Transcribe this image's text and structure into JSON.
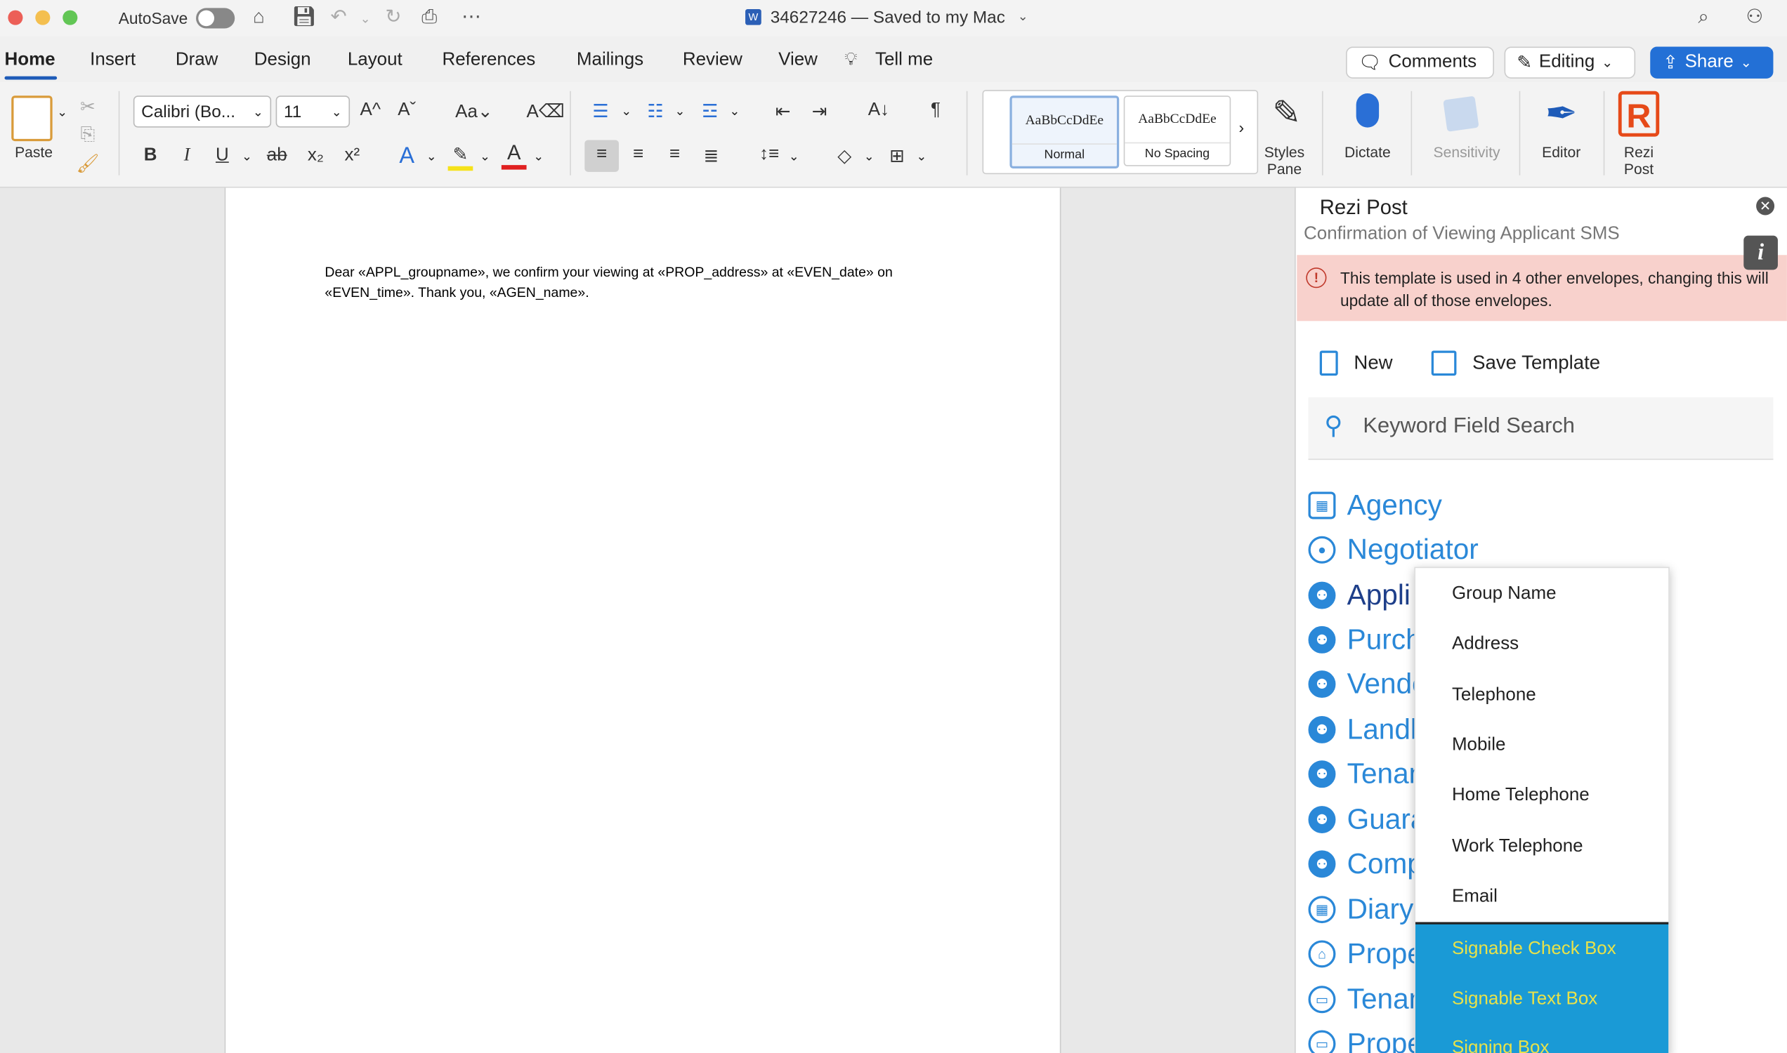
{
  "titlebar": {
    "autosave_label": "AutoSave",
    "doc_title": "34627246 — Saved to my Mac",
    "icons": [
      "home-icon",
      "save-icon",
      "undo-icon",
      "redo-icon",
      "print-icon",
      "more-icon",
      "search-icon",
      "share-people-icon"
    ]
  },
  "tabs": [
    "Home",
    "Insert",
    "Draw",
    "Design",
    "Layout",
    "References",
    "Mailings",
    "Review",
    "View",
    "Tell me"
  ],
  "header_buttons": {
    "comments": "Comments",
    "editing": "Editing",
    "share": "Share"
  },
  "ribbon": {
    "paste_label": "Paste",
    "font_name": "Calibri (Bo...",
    "font_size": "11",
    "styles": [
      {
        "sample": "AaBbCcDdEe",
        "name": "Normal"
      },
      {
        "sample": "AaBbCcDdEe",
        "name": "No Spacing"
      }
    ],
    "styles_pane": "Styles\nPane",
    "dictate": "Dictate",
    "sensitivity": "Sensitivity",
    "editor": "Editor",
    "rezi_post": "Rezi\nPost"
  },
  "document": {
    "body": "Dear «APPL_groupname», we confirm your viewing at «PROP_address» at «EVEN_date» on «EVEN_time». Thank you, «AGEN_name»."
  },
  "pane": {
    "title": "Rezi Post",
    "subtitle": "Confirmation of Viewing Applicant SMS",
    "warning": "This template is used in 4 other envelopes, changing this will update all of those envelopes.",
    "new_label": "New",
    "save_label": "Save Template",
    "search_placeholder": "Keyword Field Search",
    "categories": [
      "Agency",
      "Negotiator",
      "Appli",
      "Purch",
      "Vendo",
      "Landl",
      "Tenan",
      "Guara",
      "Comp",
      "Diary",
      "Prope",
      "Tenan",
      "Prope"
    ],
    "menu_items": [
      "Group Name",
      "Address",
      "Telephone",
      "Mobile",
      "Home Telephone",
      "Work Telephone",
      "Email"
    ],
    "menu_special": [
      "Signable Check Box",
      "Signable Text Box",
      "Signing Box"
    ]
  },
  "colors": {
    "accent": "#2370d6",
    "pane_link": "#2a88d8",
    "warning_bg": "#f8d1cc",
    "menu_special_bg": "#1a9ad6",
    "menu_special_text": "#e8e24a"
  }
}
